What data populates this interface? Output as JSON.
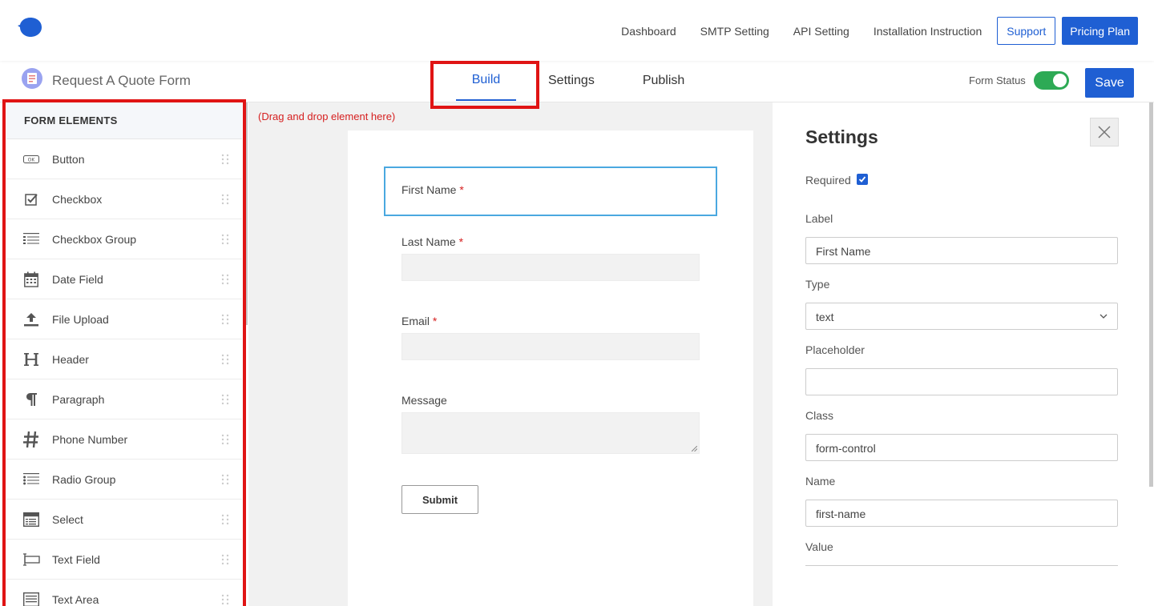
{
  "nav": {
    "links": [
      "Dashboard",
      "SMTP Setting",
      "API Setting",
      "Installation Instruction"
    ],
    "support": "Support",
    "pricing": "Pricing Plan"
  },
  "header": {
    "form_title": "Request A Quote Form",
    "tabs": [
      "Build",
      "Settings",
      "Publish"
    ],
    "active_tab": "Build",
    "form_status_label": "Form Status",
    "form_status_on": true,
    "save": "Save"
  },
  "sidebar": {
    "title": "FORM ELEMENTS",
    "items": [
      {
        "label": "Button",
        "icon": "button-icon"
      },
      {
        "label": "Checkbox",
        "icon": "checkbox-icon"
      },
      {
        "label": "Checkbox Group",
        "icon": "checkbox-group-icon"
      },
      {
        "label": "Date Field",
        "icon": "calendar-icon"
      },
      {
        "label": "File Upload",
        "icon": "upload-icon"
      },
      {
        "label": "Header",
        "icon": "header-icon"
      },
      {
        "label": "Paragraph",
        "icon": "paragraph-icon"
      },
      {
        "label": "Phone Number",
        "icon": "hash-icon"
      },
      {
        "label": "Radio Group",
        "icon": "radio-group-icon"
      },
      {
        "label": "Select",
        "icon": "select-icon"
      },
      {
        "label": "Text Field",
        "icon": "text-field-icon"
      },
      {
        "label": "Text Area",
        "icon": "text-area-icon"
      }
    ]
  },
  "canvas": {
    "drop_hint": "(Drag and drop element here)",
    "fields": {
      "first_name": "First Name",
      "last_name": "Last Name",
      "email": "Email",
      "message": "Message",
      "required_mark": "*"
    },
    "submit": "Submit"
  },
  "settings": {
    "title": "Settings",
    "required_label": "Required",
    "required_checked": true,
    "label_label": "Label",
    "label_value": "First Name",
    "type_label": "Type",
    "type_value": "text",
    "placeholder_label": "Placeholder",
    "placeholder_value": "",
    "class_label": "Class",
    "class_value": "form-control",
    "name_label": "Name",
    "name_value": "first-name",
    "value_label": "Value"
  },
  "colors": {
    "primary": "#1f5fd3",
    "toggle_on": "#2daa55",
    "required": "#d62020",
    "highlight": "#e01414",
    "selected_field": "#4aa8e0"
  }
}
